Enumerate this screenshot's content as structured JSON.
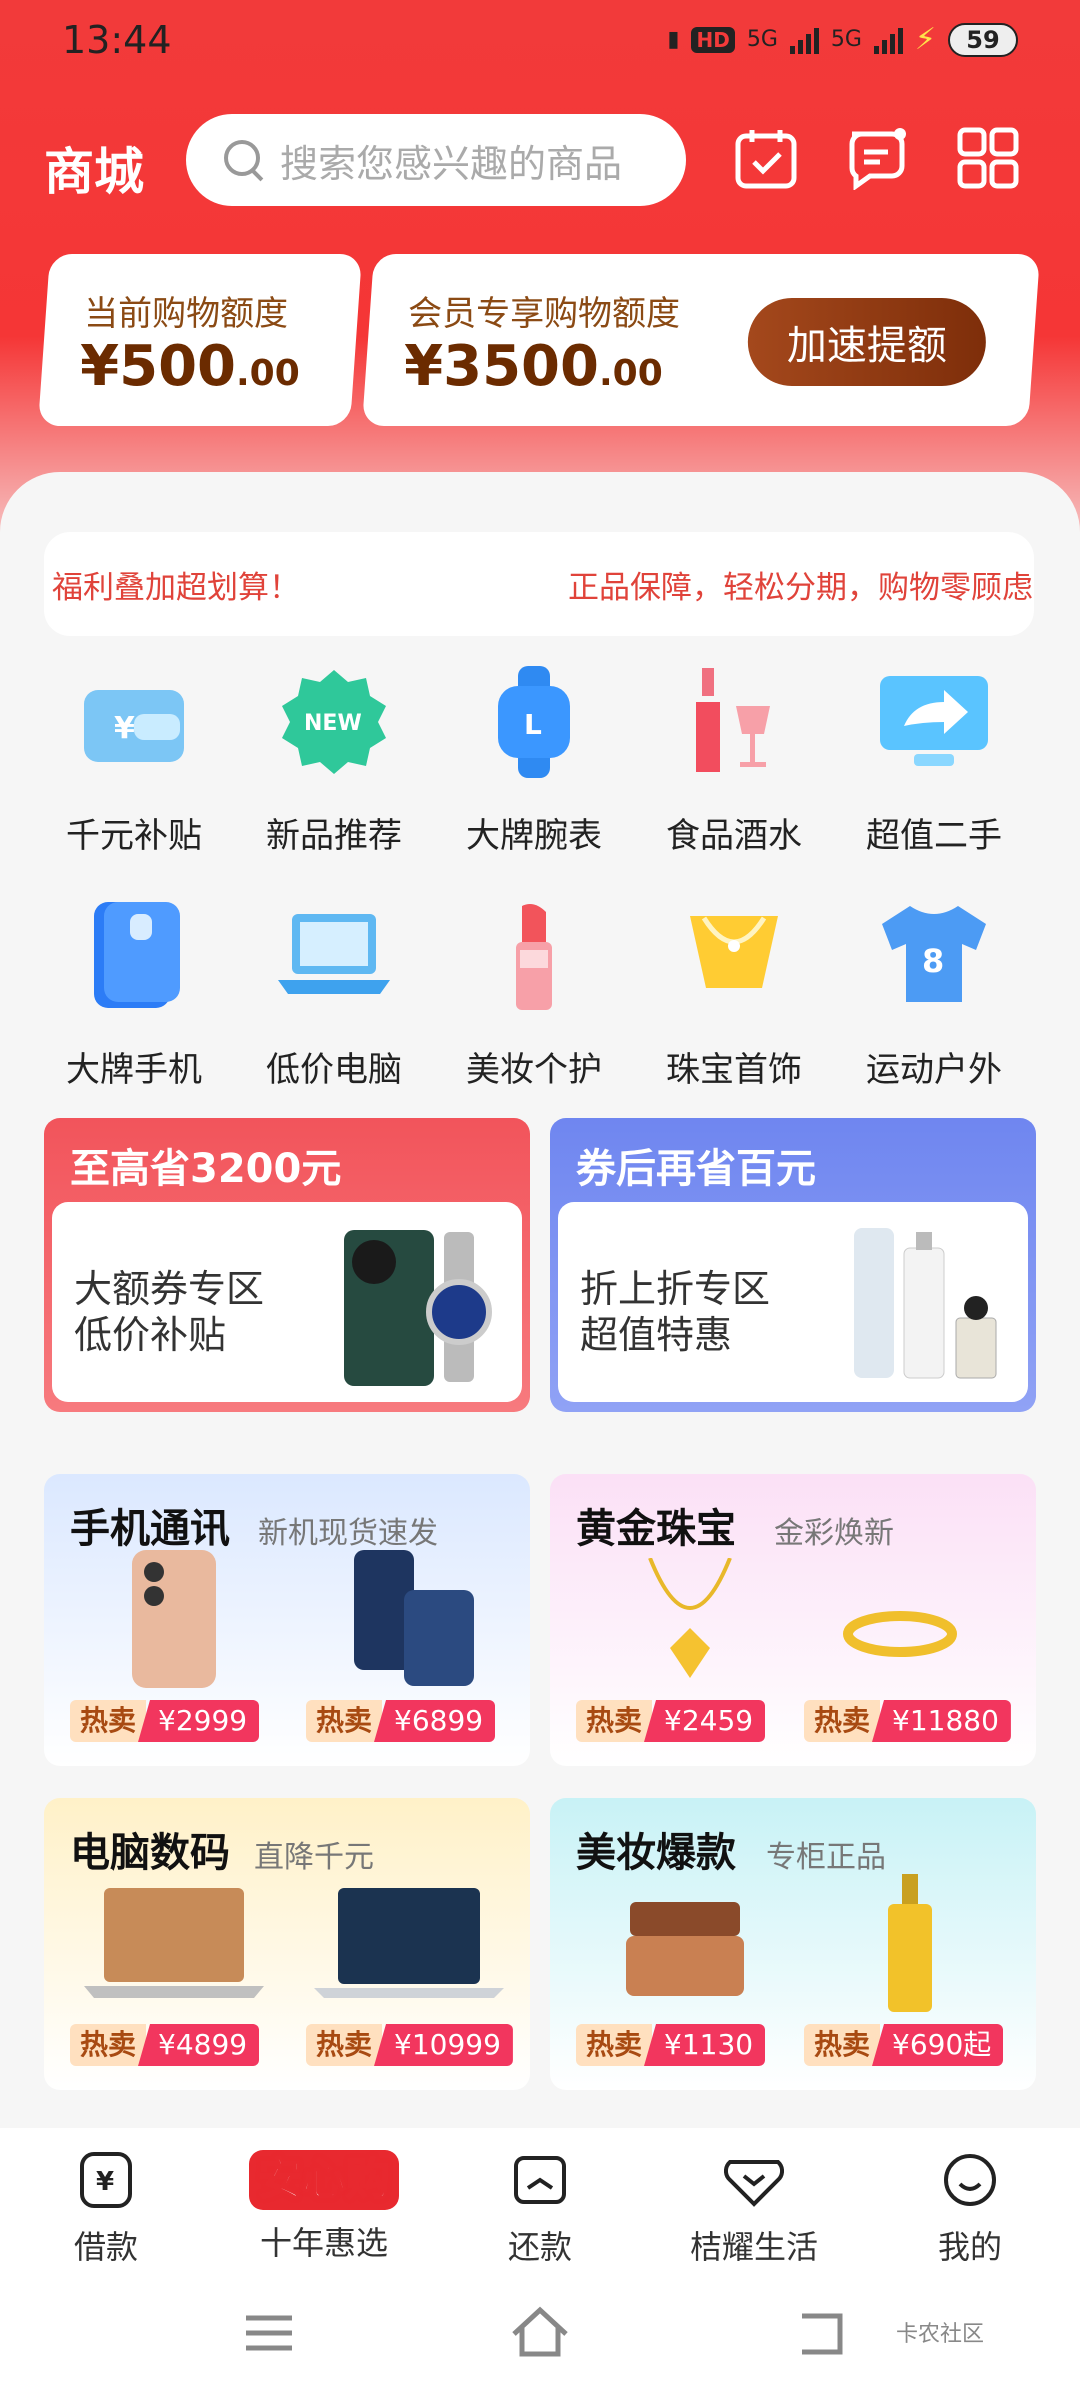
{
  "status": {
    "time": "13:44",
    "network": "5G",
    "battery": "59",
    "hd": "HD"
  },
  "header": {
    "title": "商城",
    "search_placeholder": "搜索您感兴趣的商品"
  },
  "quota": {
    "current_label": "当前购物额度",
    "current_amount": "¥500",
    "current_cents": ".00",
    "member_label": "会员专享购物额度",
    "member_amount": "¥3500",
    "member_cents": ".00",
    "boost_button": "加速提额"
  },
  "notice": {
    "left": "福利叠加超划算！",
    "right": "正品保障，轻松分期，购物零顾虑"
  },
  "categories": [
    {
      "label": "千元补贴"
    },
    {
      "label": "新品推荐",
      "badge": "NEW"
    },
    {
      "label": "大牌腕表"
    },
    {
      "label": "食品酒水"
    },
    {
      "label": "超值二手"
    },
    {
      "label": "大牌手机"
    },
    {
      "label": "低价电脑"
    },
    {
      "label": "美妆个护"
    },
    {
      "label": "珠宝首饰"
    },
    {
      "label": "运动户外"
    }
  ],
  "promos": [
    {
      "heading": "至高省3200元",
      "line1": "大额券专区",
      "line2": "低价补贴",
      "color": "#f2545b"
    },
    {
      "heading": "券后再省百元",
      "line1": "折上折专区",
      "line2": "超值特惠",
      "color": "#6f86f0"
    }
  ],
  "tiles": [
    {
      "title": "手机通讯",
      "subtitle": "新机现货速发",
      "hot": "热卖",
      "p1": "¥2999",
      "p2": "¥6899"
    },
    {
      "title": "黄金珠宝",
      "subtitle": "金彩焕新",
      "hot": "热卖",
      "p1": "¥2459",
      "p2": "¥11880"
    },
    {
      "title": "电脑数码",
      "subtitle": "直降千元",
      "hot": "热卖",
      "p1": "¥4899",
      "p2": "¥10999"
    },
    {
      "title": "美妆爆款",
      "subtitle": "专柜正品",
      "hot": "热卖",
      "p1": "¥1130",
      "p2": "¥690起"
    }
  ],
  "nav": [
    {
      "label": "借款"
    },
    {
      "label": "十年惠选",
      "badge": "安心购"
    },
    {
      "label": "还款"
    },
    {
      "label": "桔耀生活"
    },
    {
      "label": "我的"
    }
  ],
  "watermark": "卡农社区"
}
